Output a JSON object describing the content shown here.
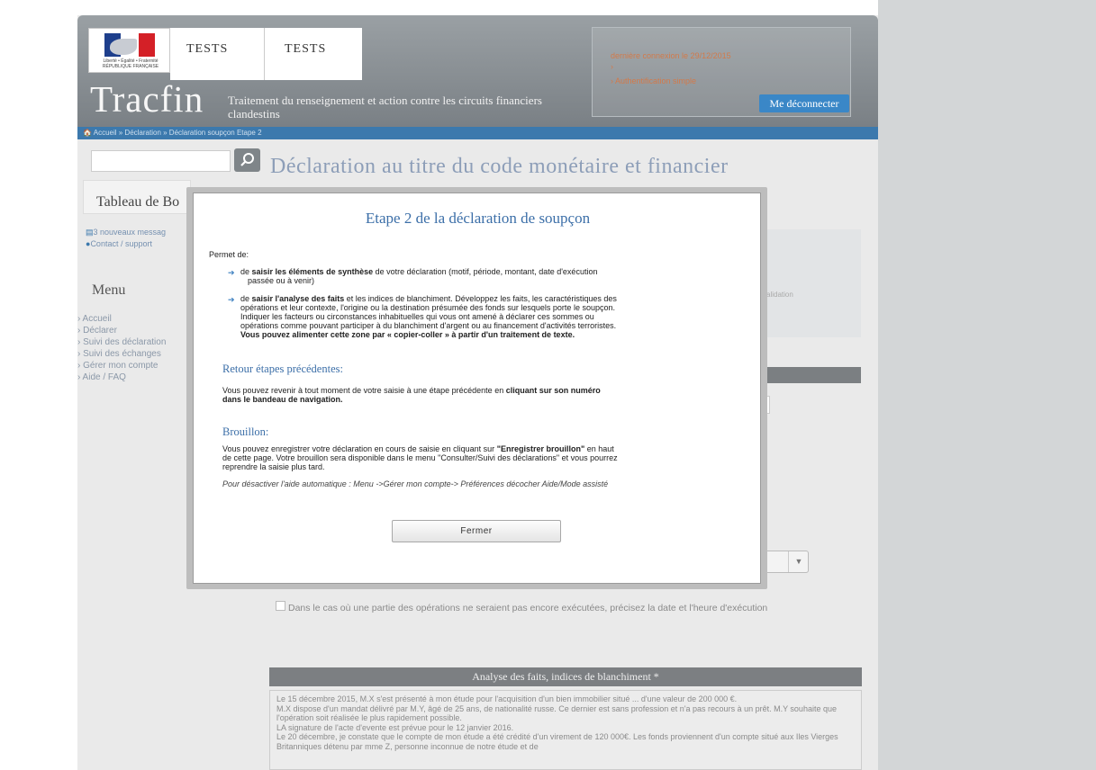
{
  "header": {
    "motto": "Liberté • Égalité • Fraternité",
    "republic": "RÉPUBLIQUE FRANÇAISE",
    "tests_1": "TESTS",
    "tests_2": "TESTS",
    "brand": "Tracfin",
    "tagline": "Traitement du renseignement et action contre les circuits financiers clandestins",
    "last_login": "dernière connexion le 29/12/2015",
    "auth": "› Authentification simple",
    "logout_label": "Me déconnecter"
  },
  "breadcrumb": "🏠 Accueil » Déclaration » Déclaration soupçon Etape 2",
  "search": {
    "placeholder": ""
  },
  "page_title": "Déclaration au titre du code monétaire et financier",
  "sidebar": {
    "dashboard_title": "Tableau de Bo",
    "messages": "3 nouveaux messag",
    "contact": "Contact / support",
    "menu_title": "Menu",
    "menu_items": [
      "› Accueil",
      "› Déclarer",
      "› Suivi des déclaration",
      "› Suivi des échanges",
      "› Gérer mon compte",
      "› Aide / FAQ"
    ]
  },
  "right_panel": {
    "text": "validation"
  },
  "checkbox_label": "Dans le cas où une partie des opérations ne seraient pas encore exécutées, précisez la date et l'heure d'exécution",
  "analysis": {
    "title": "Analyse des faits, indices de blanchiment *",
    "lines": [
      "Le 15 décembre 2015, M.X s'est présenté à mon étude pour l'acquisition d'un bien immobilier situé ... d'une valeur de 200 000 €.",
      "M.X dispose d'un mandat délivré par M.Y, âgé de 25 ans, de nationalité russe. Ce dernier est sans profession et n'a pas recours à un prêt. M.Y souhaite que l'opération soit réalisée le plus rapidement possible.",
      "LA signature de l'acte d'evente est prévue pour le 12 janvier 2016.",
      "Le 20 décembre, je constate que le compte de mon étude a été crédité d'un virement de 120 000€. Les fonds proviennent d'un compte situé aux Iles Vierges Britanniques détenu par mme Z, personne inconnue de notre étude et de"
    ]
  },
  "modal": {
    "title": "Etape 2 de la déclaration de soupçon",
    "intro": "Permet de:",
    "b1_pre": "de ",
    "b1_bold": "saisir les éléments de synthèse",
    "b1_line1": " de votre déclaration (motif, période, montant, date d'exécution",
    "b1_line2": "passée ou à venir)",
    "b2_pre": "de ",
    "b2_bold": "saisir l'analyse des faits",
    "b2_line1": " et les indices de blanchiment. Développez les faits, les caractéristiques des",
    "b2_line2": "opérations et leur contexte, l'origine ou la destination présumée des fonds sur lesquels porte le soupçon.",
    "b2_line3": "Indiquer les facteurs ou circonstances inhabituelles qui vous ont amené à déclarer ces sommes ou",
    "b2_line4": "opérations comme pouvant participer à du blanchiment d'argent ou au financement d'activités terroristes.",
    "b2_line5": "Vous pouvez alimenter cette zone par « copier-coller » à partir d'un traitement de texte.",
    "retour_title": "Retour étapes précédentes:",
    "retour_line1_pre": "Vous pouvez revenir à tout moment de votre saisie à une étape précédente en ",
    "retour_line1_bold": "cliquant sur son numéro",
    "retour_line2": "dans le bandeau de navigation.",
    "brouillon_title": "Brouillon:",
    "brouillon_line1_pre": "Vous pouvez enregistrer votre déclaration en cours de saisie en cliquant sur ",
    "brouillon_line1_bold": "\"Enregistrer brouillon\"",
    "brouillon_line1_post": " en haut",
    "brouillon_line2": "de cette page. Votre brouillon sera disponible dans le menu \"Consulter/Suivi des déclarations\" et vous pourrez",
    "brouillon_line3": "reprendre la saisie plus tard.",
    "help_note": "Pour désactiver l'aide automatique : Menu ->Gérer mon compte-> Préférences décocher Aide/Mode assisté",
    "close_label": "Fermer"
  }
}
